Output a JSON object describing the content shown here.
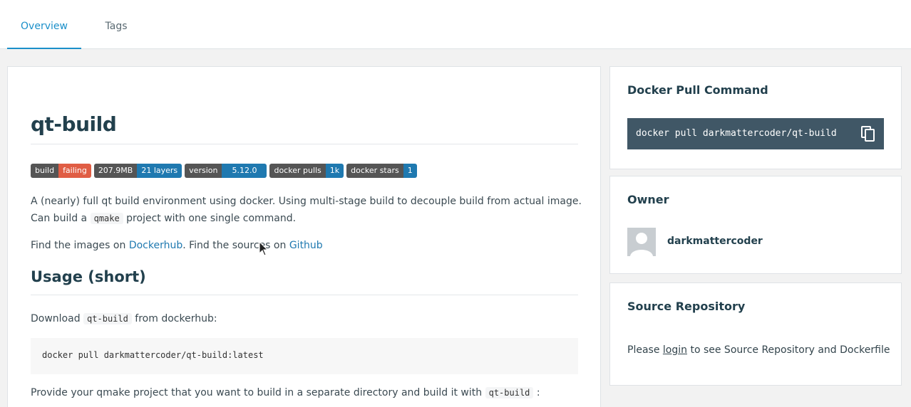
{
  "tabs": [
    {
      "label": "Overview",
      "active": true
    },
    {
      "label": "Tags",
      "active": false
    }
  ],
  "readme": {
    "title": "qt-build",
    "badges": [
      {
        "left": "build",
        "right": "failing",
        "color": "#e05d44"
      },
      {
        "left": "207.9MB",
        "right": "21 layers",
        "color": "#1f79b0"
      },
      {
        "left": "version",
        "right": "5.12.0",
        "color": "#1f79b0"
      },
      {
        "left": "docker pulls",
        "right": "1k",
        "color": "#1f79b0"
      },
      {
        "left": "docker stars",
        "right": "1",
        "color": "#1f79b0"
      }
    ],
    "intro_line1": "A (nearly) full qt build environment using docker. Using multi-stage build to decouple build from actual image.",
    "intro_line2_before": "Can build a ",
    "intro_line2_code": "qmake",
    "intro_line2_after": " project with one single command.",
    "find_before": "Find the images on ",
    "find_link1": "Dockerhub",
    "find_middle": ". Find the sources on ",
    "find_link2": "Github",
    "usage_heading": "Usage (short)",
    "download_before": "Download ",
    "download_code": "qt-build",
    "download_after": " from dockerhub:",
    "download_command": "docker pull darkmattercoder/qt-build:latest",
    "provide_before": "Provide your qmake project that you want to build in a separate directory and build it with ",
    "provide_code": "qt-build",
    "provide_after": " :"
  },
  "sidebar": {
    "pull": {
      "title": "Docker Pull Command",
      "command": "docker pull darkmattercoder/qt-build",
      "copy_icon": "copy-icon"
    },
    "owner": {
      "title": "Owner",
      "name": "darkmattercoder"
    },
    "source": {
      "title": "Source Repository",
      "before": "Please ",
      "login": "login",
      "after": " to see Source Repository and Dockerfile"
    }
  },
  "colors": {
    "accent": "#1a8fc9",
    "link": "#1f79b0",
    "command_bg": "#405766",
    "badge_fail": "#e05d44",
    "badge_blue": "#1f79b0"
  }
}
